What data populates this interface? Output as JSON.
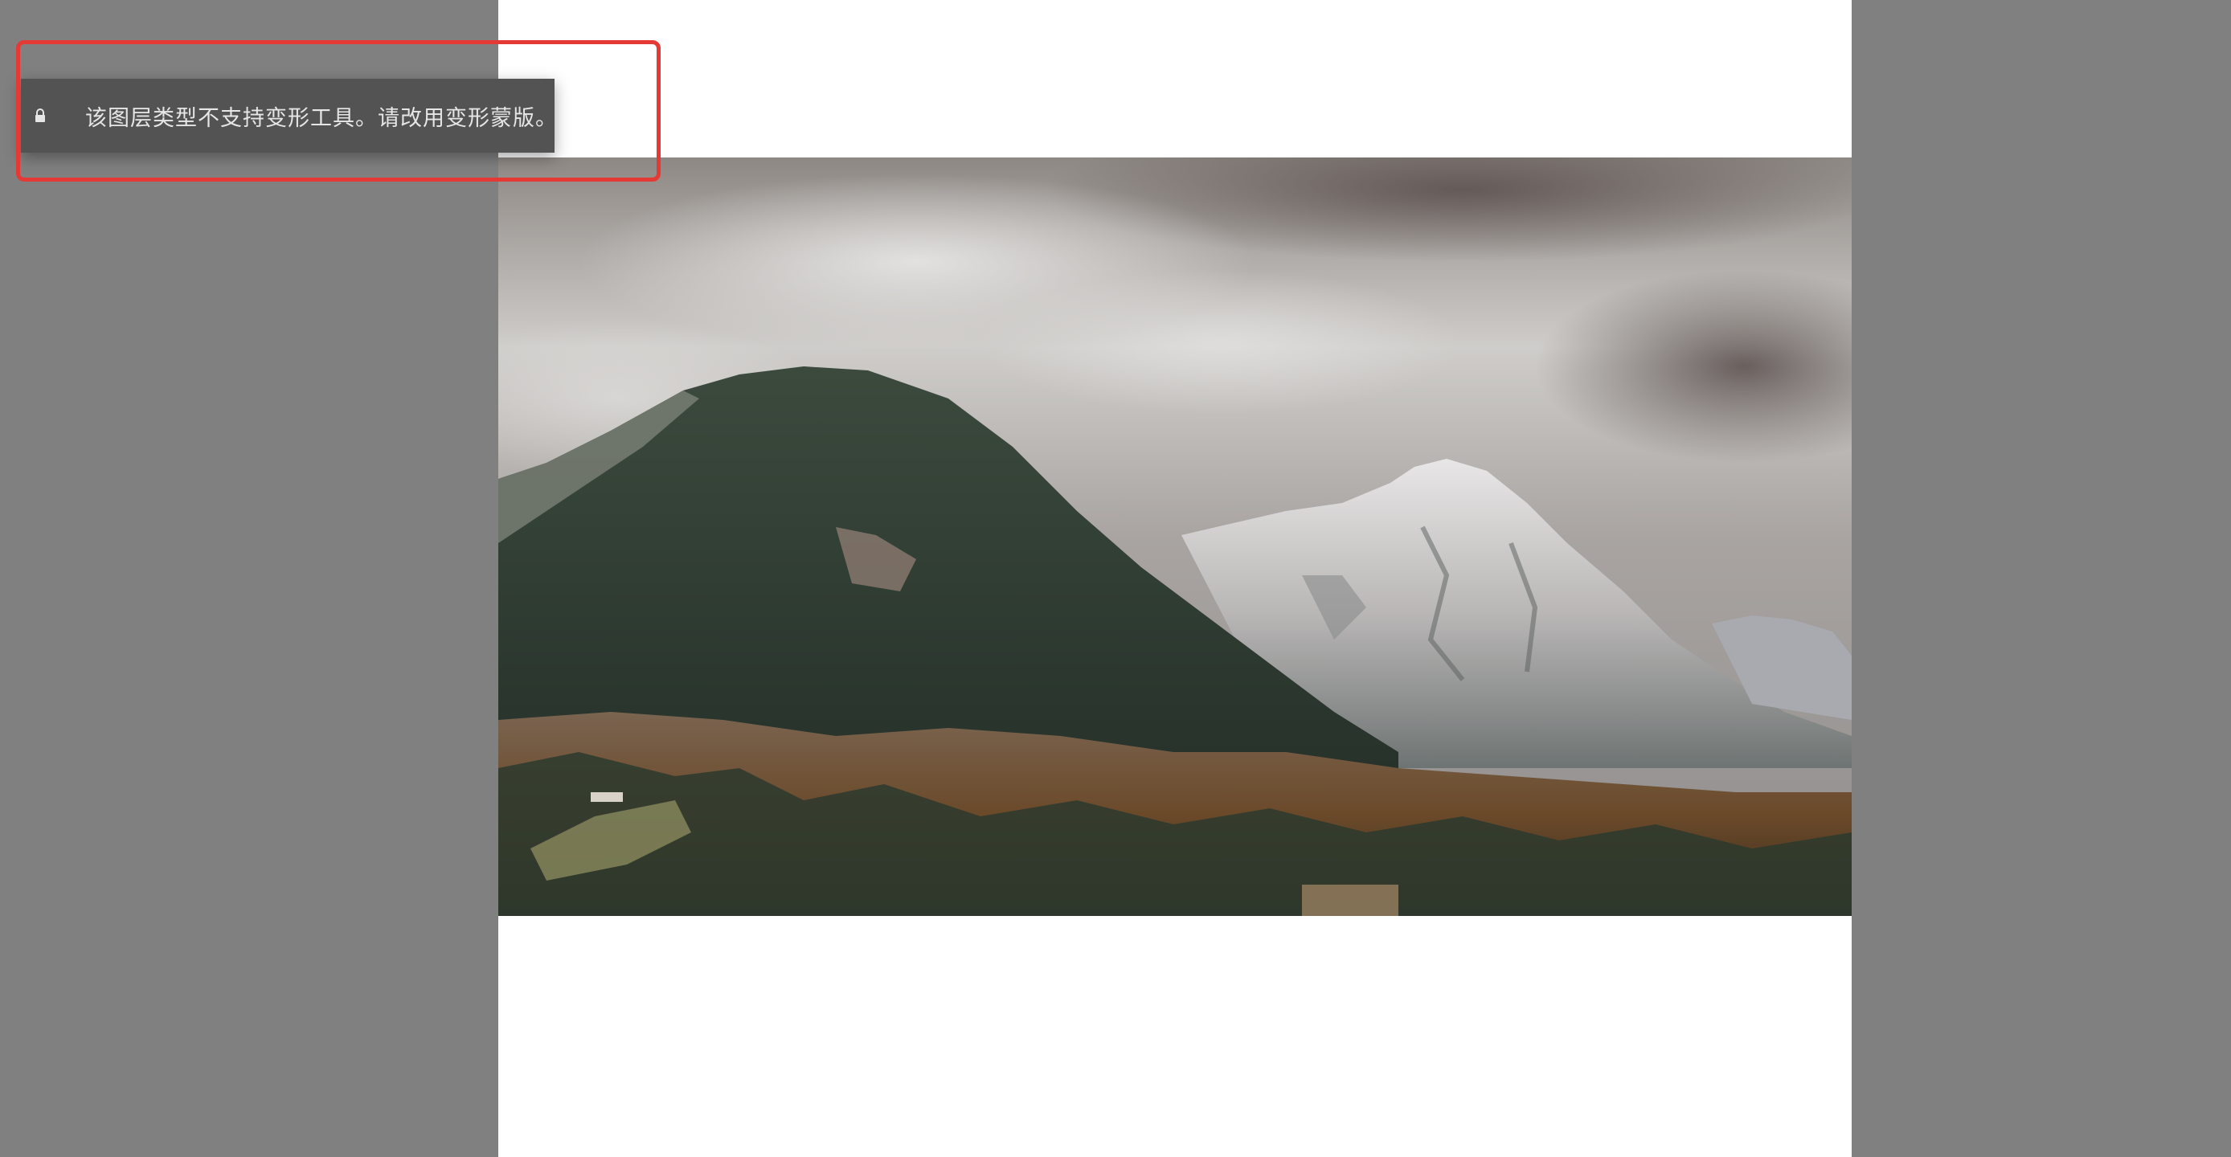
{
  "toast": {
    "icon": "lock-icon",
    "message": "该图层类型不支持变形工具。请改用变形蒙版。"
  },
  "annotation": {
    "highlight_color": "#e53935"
  },
  "colors": {
    "workspace_bg": "#808080",
    "canvas_bg": "#ffffff",
    "toast_bg": "#535353",
    "toast_text": "#e6e6e6"
  }
}
